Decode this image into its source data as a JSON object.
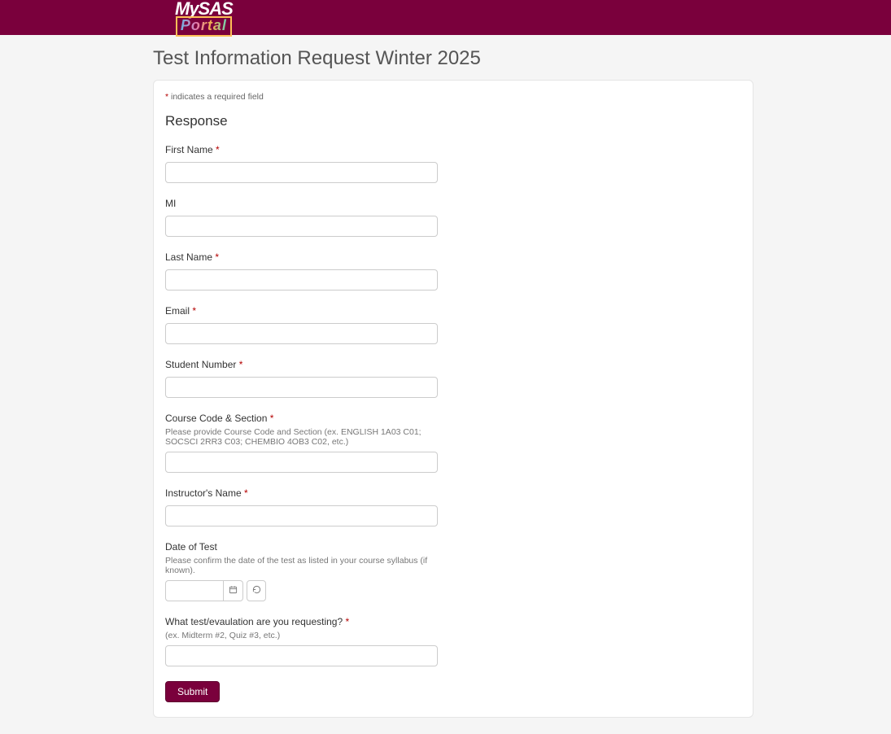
{
  "logo": {
    "line1": "MySAS",
    "line2": "Portal"
  },
  "page_title": "Test Information Request Winter 2025",
  "required_note": " indicates a required field",
  "response_heading": "Response",
  "fields": {
    "first_name": {
      "label": "First Name "
    },
    "mi": {
      "label": "MI"
    },
    "last_name": {
      "label": "Last Name "
    },
    "email": {
      "label": "Email "
    },
    "student_no": {
      "label": "Student Number "
    },
    "course": {
      "label": "Course Code & Section ",
      "help": "Please provide Course Code and Section (ex. ENGLISH 1A03 C01; SOCSCI 2RR3 C03; CHEMBIO 4OB3 C02, etc.)"
    },
    "instructor": {
      "label": "Instructor's Name "
    },
    "date": {
      "label": "Date of Test",
      "help": "Please confirm the date of the test as listed in your course syllabus (if known)."
    },
    "what_test": {
      "label": "What test/evaulation are you requesting? ",
      "help": "(ex. Midterm #2, Quiz #3, etc.)"
    }
  },
  "submit_label": "Submit",
  "star": "*"
}
